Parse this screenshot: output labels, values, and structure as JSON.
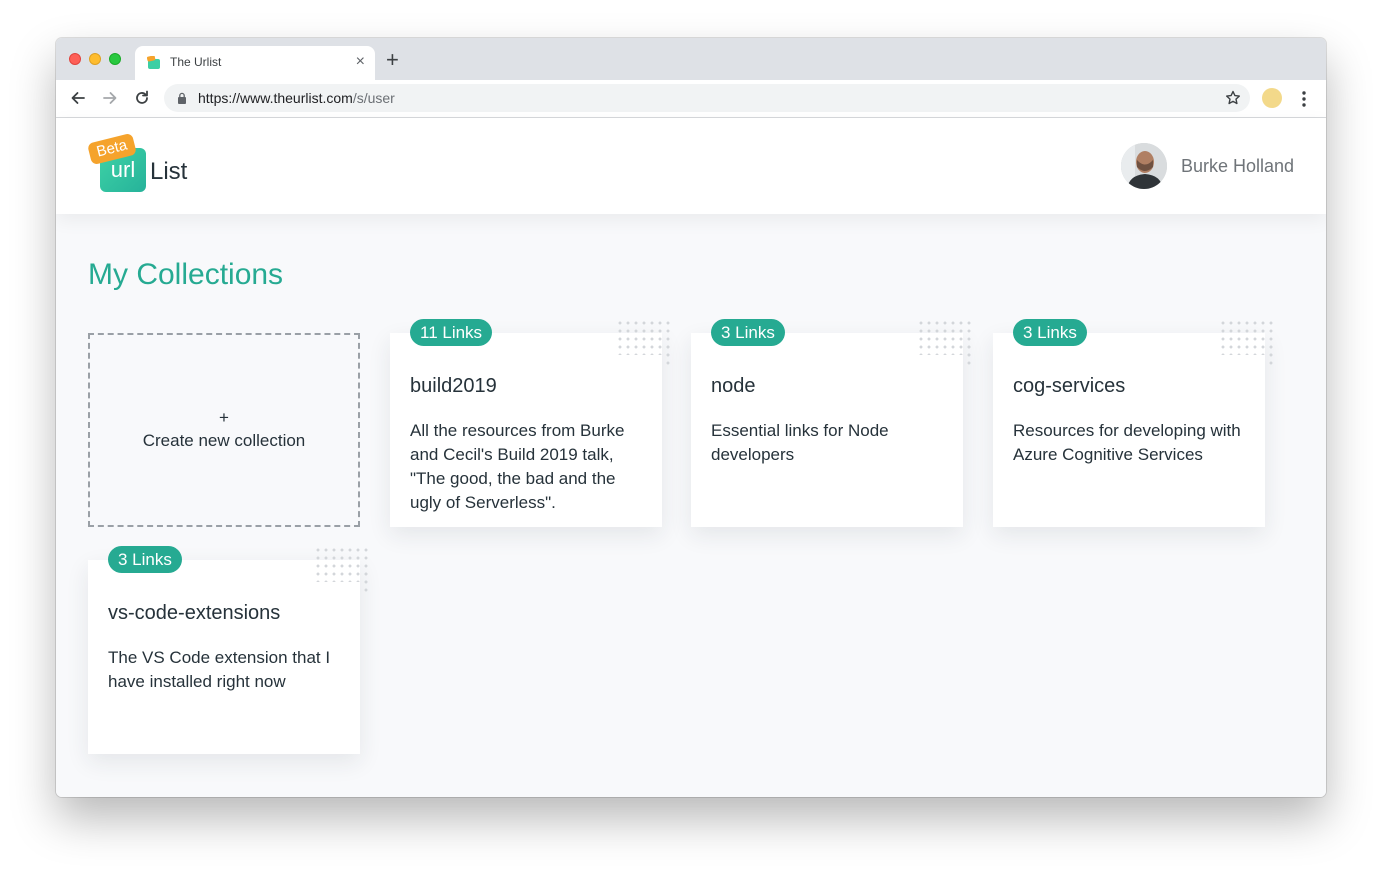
{
  "browser": {
    "tab_title": "The Urlist",
    "tab_close": "×",
    "new_tab": "+",
    "url_host": "https://www.theurlist.com",
    "url_path": "/s/user"
  },
  "header": {
    "logo_url_text": "url",
    "logo_list_text": "List",
    "logo_badge": "Beta",
    "user_name": "Burke Holland"
  },
  "main": {
    "title": "My Collections",
    "create_plus": "+",
    "create_label": "Create new collection",
    "collections": [
      {
        "links": "11 Links",
        "title": "build2019",
        "description": "All the resources from Burke and Cecil's Build 2019 talk, \"The good, the bad and the ugly of Serverless\"."
      },
      {
        "links": "3 Links",
        "title": "node",
        "description": "Essential links for Node developers"
      },
      {
        "links": "3 Links",
        "title": "cog-services",
        "description": "Resources for developing with Azure Cognitive Services"
      },
      {
        "links": "3 Links",
        "title": "vs-code-extensions",
        "description": "The VS Code extension that I have installed right now"
      }
    ]
  },
  "colors": {
    "accent": "#26aa92",
    "beta_badge": "#f5a32c",
    "text": "#26323a",
    "muted_text": "#6f7479"
  }
}
